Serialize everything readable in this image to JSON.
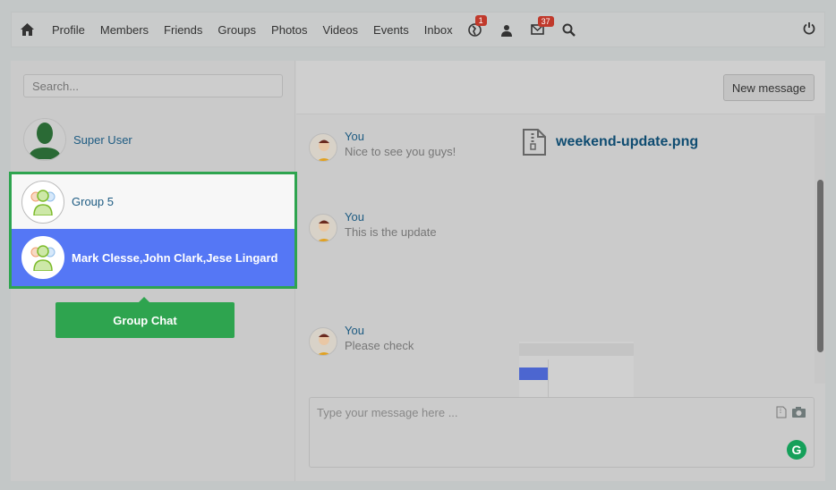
{
  "nav": {
    "items": [
      "Profile",
      "Members",
      "Friends",
      "Groups",
      "Photos",
      "Videos",
      "Events",
      "Inbox"
    ],
    "icons": {
      "home": "home-icon",
      "notifications": "globe-icon",
      "friend_requests": "users-icon",
      "messages": "envelope-icon",
      "search": "search-icon",
      "logout": "power-icon"
    },
    "notifications_count": "1",
    "messages_count": "37"
  },
  "sidebar": {
    "search_placeholder": "Search...",
    "conversations": [
      {
        "name": "Super User"
      },
      {
        "name": "Group 5"
      },
      {
        "name": "Mark Clesse,John Clark,Jese Lingard",
        "selected": true
      }
    ],
    "tooltip": "Group Chat"
  },
  "header": {
    "new_message": "New message"
  },
  "messages": [
    {
      "sender": "You",
      "text": "Nice to see you guys!",
      "attachment": "weekend-update.png"
    },
    {
      "sender": "You",
      "text": "This is the update"
    },
    {
      "sender": "You",
      "text": "Please check"
    }
  ],
  "composer": {
    "placeholder": "Type your message here ...",
    "grammarly": "G"
  },
  "colors": {
    "selected": "#5577f5",
    "highlight": "#2ea44f",
    "link": "#1d5b82",
    "badge": "#c0392b"
  }
}
